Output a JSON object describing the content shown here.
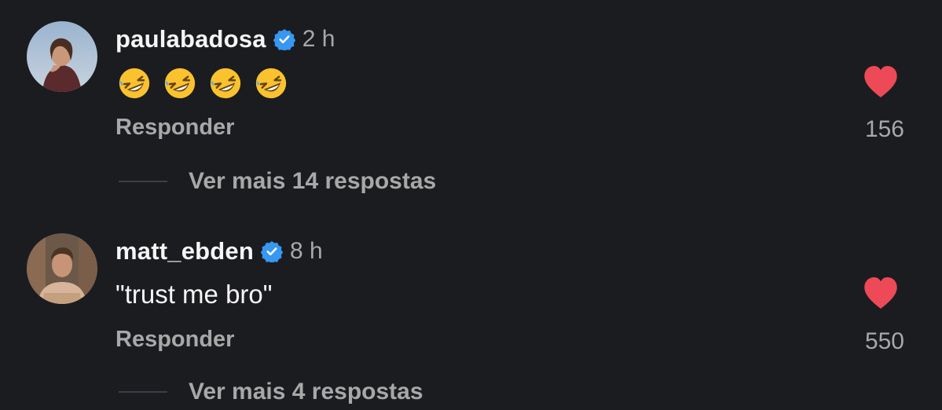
{
  "comments": [
    {
      "username": "paulabadosa",
      "time": "2 h",
      "text": "",
      "emoji": [
        "rolling-on-floor-laughing",
        "rolling-on-floor-laughing",
        "rolling-on-floor-laughing",
        "rolling-on-floor-laughing"
      ],
      "reply_label": "Responder",
      "like_count": "156",
      "liked": true,
      "more_replies": "Ver mais 14 respostas"
    },
    {
      "username": "matt_ebden",
      "time": "8 h",
      "text": "\"trust me bro\"",
      "reply_label": "Responder",
      "like_count": "550",
      "liked": true,
      "more_replies": "Ver mais 4 respostas"
    }
  ],
  "colors": {
    "background": "#1b1c20",
    "verified_badge": "#3897f0",
    "heart": "#ed4956",
    "secondary_text": "#a8a8a8"
  },
  "icons": {
    "verified": "verified-badge-icon",
    "like": "heart-icon",
    "emoji": "rolling-on-floor-laughing-emoji"
  }
}
